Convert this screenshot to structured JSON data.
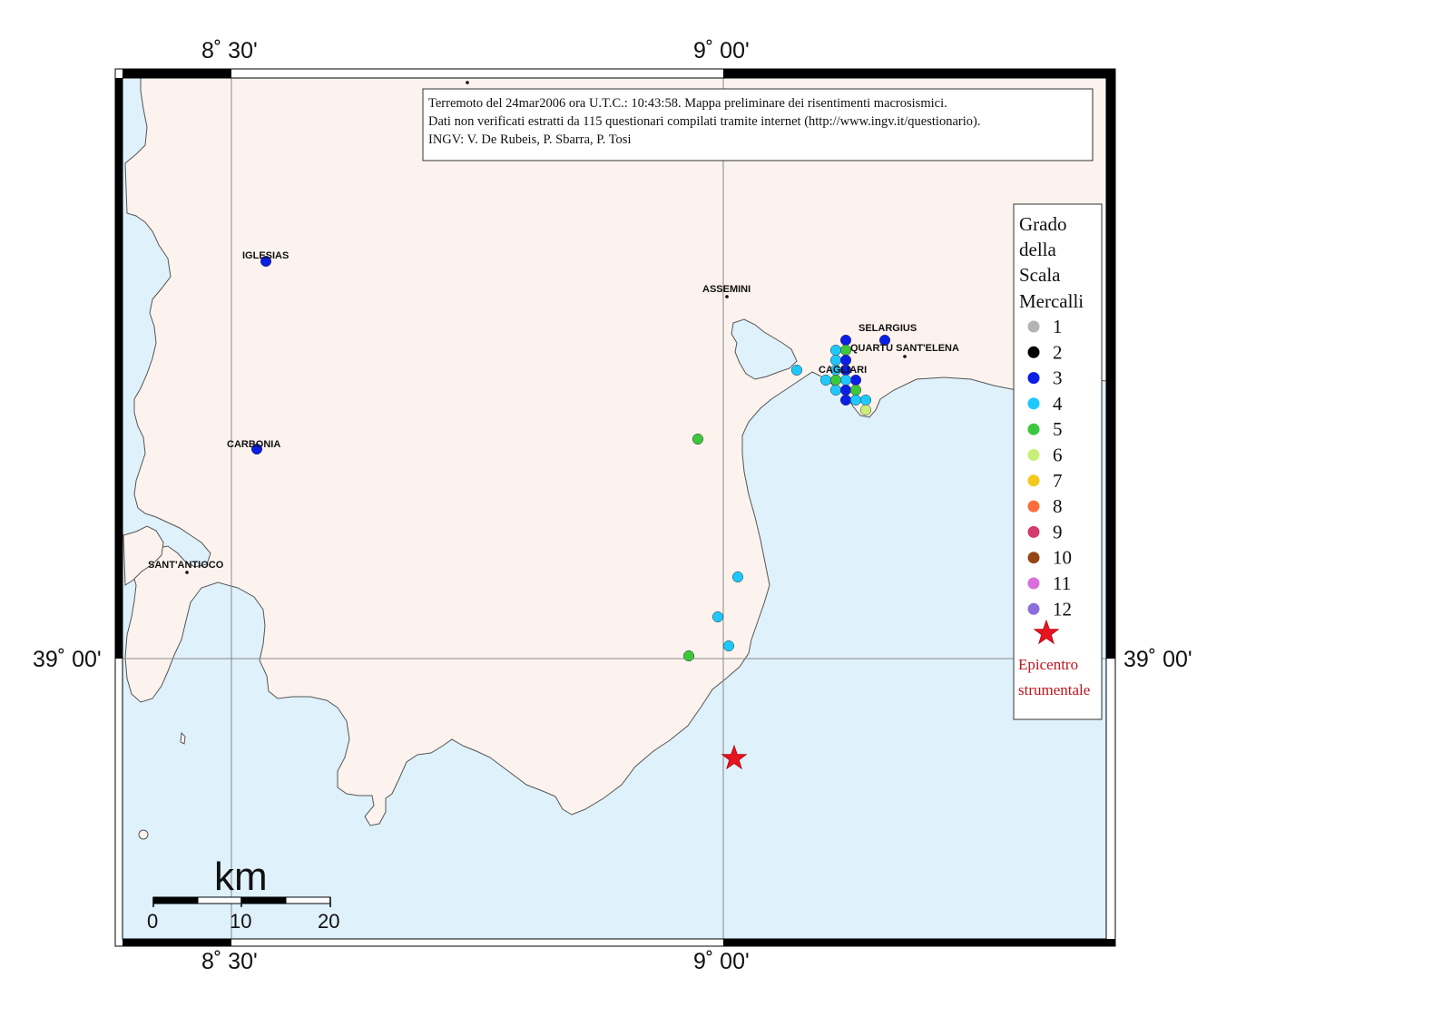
{
  "info_box": {
    "lines": [
      "Terremoto del 24mar2006 ora U.T.C.: 10:43:58.  Mappa preliminare dei risentimenti macrosismici.",
      "Dati non verificati estratti da 115 questionari compilati tramite internet (http://www.ingv.it/questionario).",
      "INGV: V.  De Rubeis, P.  Sbarra, P.  Tosi"
    ]
  },
  "axes": {
    "lon_ticks": [
      "8˚ 30'",
      "9˚ 00'"
    ],
    "lat_ticks": [
      "39˚ 00'"
    ]
  },
  "legend": {
    "title_lines": [
      "Grado",
      "della",
      "Scala",
      "Mercalli"
    ],
    "grades": [
      {
        "label": "1",
        "color": "#b4b4b4"
      },
      {
        "label": "2",
        "color": "#000000"
      },
      {
        "label": "3",
        "color": "#0a1ee6"
      },
      {
        "label": "4",
        "color": "#1ec8ff"
      },
      {
        "label": "5",
        "color": "#3cc83c"
      },
      {
        "label": "6",
        "color": "#c8f078"
      },
      {
        "label": "7",
        "color": "#f5c81e"
      },
      {
        "label": "8",
        "color": "#fa6e3c"
      },
      {
        "label": "9",
        "color": "#d23c6e"
      },
      {
        "label": "10",
        "color": "#964614"
      },
      {
        "label": "11",
        "color": "#dc6edc"
      },
      {
        "label": "12",
        "color": "#8c6edc"
      }
    ],
    "epicenter_lines": [
      "Epicentro",
      "strumentale"
    ],
    "epicenter_color": "#e6141e"
  },
  "cities": [
    "IGLESIAS",
    "ASSEMINI",
    "SELARGIUS",
    "QUARTU SANT'ELENA",
    "CAGLIARI",
    "CARBONIA",
    "SANT'ANTIOCO"
  ],
  "scale_bar": {
    "unit": "km",
    "ticks": [
      "0",
      "10",
      "20"
    ]
  },
  "colors": {
    "land": "#fdf3ee",
    "sea": "#dff1fb",
    "coast": "#555555"
  }
}
